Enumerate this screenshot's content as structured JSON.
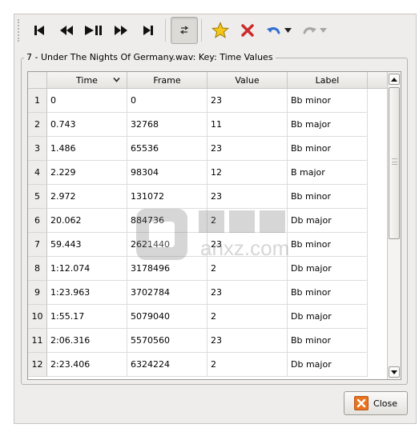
{
  "group_title": "7 - Under The Nights Of Germany.wav: Key: Time Values",
  "table": {
    "columns": [
      "Time",
      "Frame",
      "Value",
      "Label"
    ],
    "rows": [
      {
        "num": "1",
        "time": "0",
        "frame": "0",
        "value": "23",
        "label": "Bb minor"
      },
      {
        "num": "2",
        "time": "0.743",
        "frame": "32768",
        "value": "11",
        "label": "Bb major"
      },
      {
        "num": "3",
        "time": "1.486",
        "frame": "65536",
        "value": "23",
        "label": "Bb minor"
      },
      {
        "num": "4",
        "time": "2.229",
        "frame": "98304",
        "value": "12",
        "label": "B major"
      },
      {
        "num": "5",
        "time": "2.972",
        "frame": "131072",
        "value": "23",
        "label": "Bb minor"
      },
      {
        "num": "6",
        "time": "20.062",
        "frame": "884736",
        "value": "2",
        "label": "Db major"
      },
      {
        "num": "7",
        "time": "59.443",
        "frame": "2621440",
        "value": "23",
        "label": "Bb minor"
      },
      {
        "num": "8",
        "time": "1:12.074",
        "frame": "3178496",
        "value": "2",
        "label": "Db major"
      },
      {
        "num": "9",
        "time": "1:23.963",
        "frame": "3702784",
        "value": "23",
        "label": "Bb minor"
      },
      {
        "num": "10",
        "time": "1:55.17",
        "frame": "5079040",
        "value": "2",
        "label": "Db major"
      },
      {
        "num": "11",
        "time": "2:06.316",
        "frame": "5570560",
        "value": "23",
        "label": "Bb minor"
      },
      {
        "num": "12",
        "time": "2:23.406",
        "frame": "6324224",
        "value": "2",
        "label": "Db major"
      }
    ]
  },
  "toolbar": {
    "buttons": [
      "rewind-start-icon",
      "rewind-icon",
      "play-pause-icon",
      "fast-forward-icon",
      "fast-forward-end-icon",
      "follow-playback-icon",
      "star-icon",
      "delete-icon",
      "undo-icon",
      "redo-icon"
    ]
  },
  "close_button": {
    "label": "Close"
  },
  "watermark": {
    "text": "anxz.com"
  },
  "colors": {
    "window_bg": "#eeedeb",
    "star": "#f5c518",
    "delete": "#cc2b2b",
    "undo": "#2f6fd0",
    "close_icon": "#e8731f"
  }
}
